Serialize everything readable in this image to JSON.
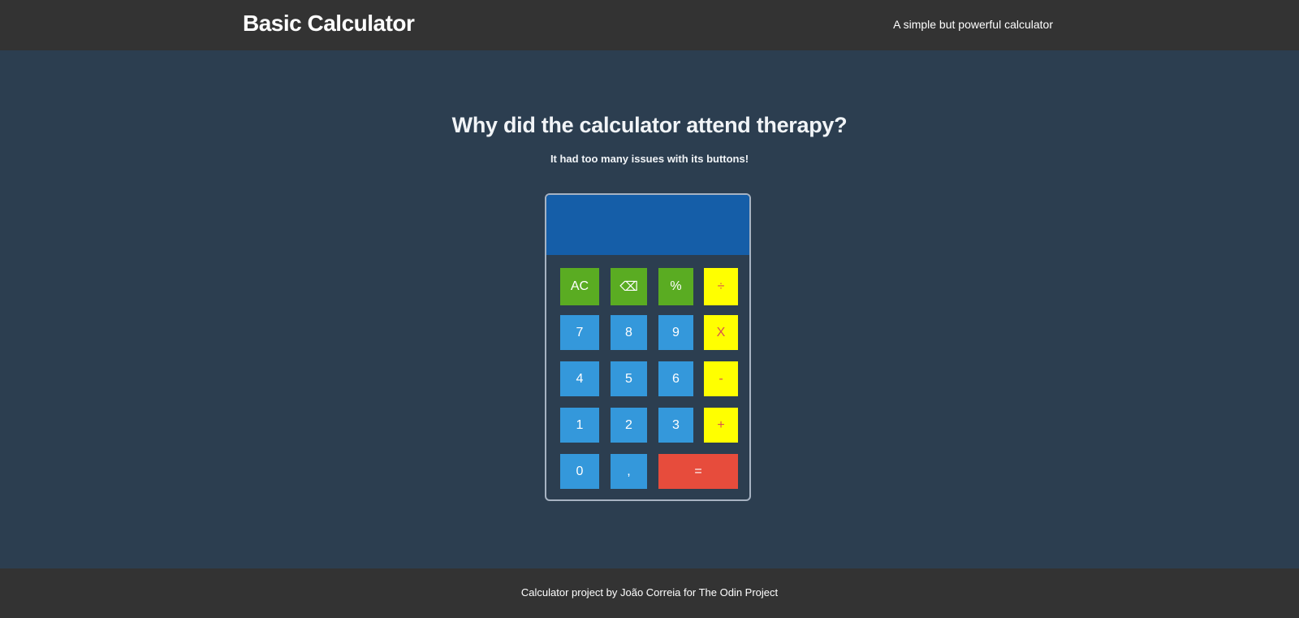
{
  "header": {
    "title": "Basic Calculator",
    "tagline": "A simple but powerful calculator"
  },
  "joke": {
    "question": "Why did the calculator attend therapy?",
    "answer": "It had too many issues with its buttons!"
  },
  "calculator": {
    "display_value": "",
    "keys": {
      "ac": "AC",
      "backspace": "⌫",
      "percent": "%",
      "divide": "÷",
      "seven": "7",
      "eight": "8",
      "nine": "9",
      "multiply": "X",
      "four": "4",
      "five": "5",
      "six": "6",
      "subtract": "-",
      "one": "1",
      "two": "2",
      "three": "3",
      "add": "+",
      "zero": "0",
      "decimal": ",",
      "equals": "="
    }
  },
  "footer": {
    "text": "Calculator project by João Correia for The Odin Project"
  },
  "colors": {
    "header_bg": "#333333",
    "main_bg": "#2c3e50",
    "display_bg": "#155ea8",
    "function_key": "#5aac22",
    "number_key": "#3498db",
    "operator_key": "#ffff00",
    "equals_key": "#e74c3c"
  }
}
